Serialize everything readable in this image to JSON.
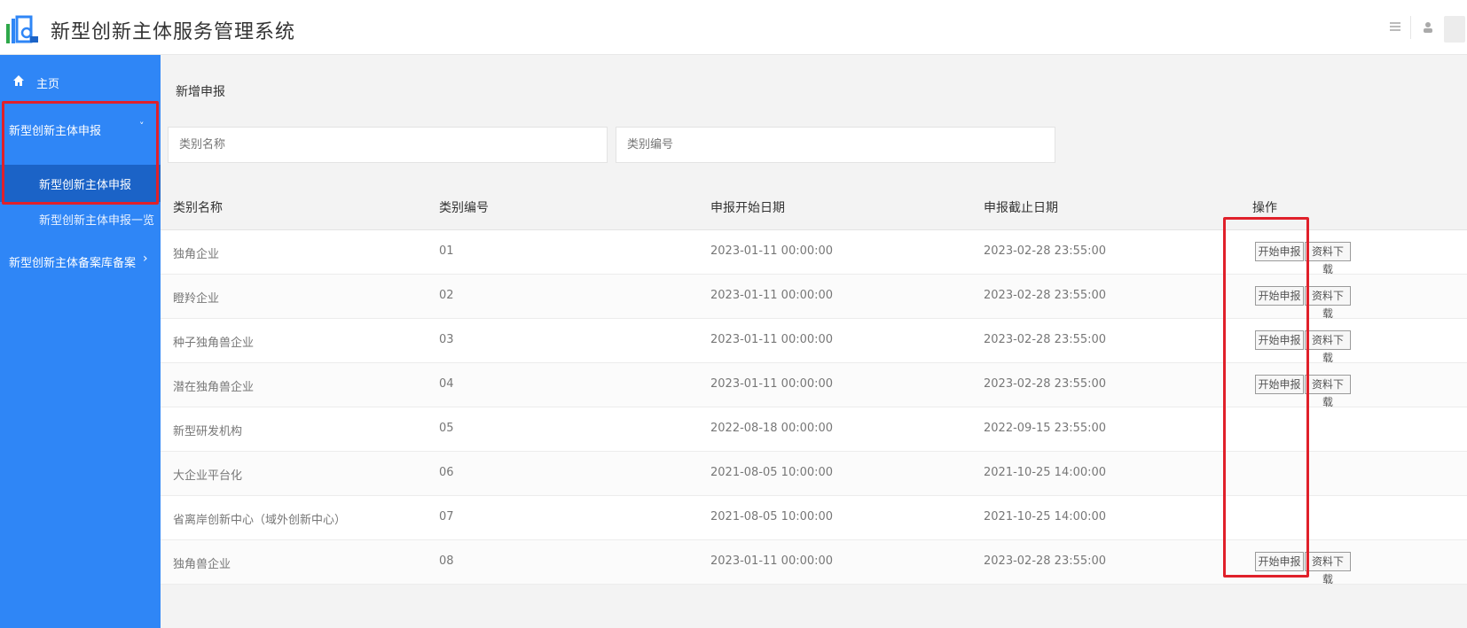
{
  "app": {
    "title": "新型创新主体服务管理系统",
    "user_label": ""
  },
  "sidebar": {
    "home": {
      "icon": "home-icon",
      "label": "主页"
    },
    "group1": {
      "label": "新型创新主体申报",
      "chevron": "˅"
    },
    "sub_active": {
      "label": "新型创新主体申报"
    },
    "sub2": {
      "label": "新型创新主体申报一览"
    },
    "group2": {
      "label": "新型创新主体备案库备案",
      "chevron": "›"
    }
  },
  "main": {
    "panel_title": "新增申报",
    "search": {
      "name_placeholder": "类别名称",
      "code_placeholder": "类别编号"
    },
    "table": {
      "headers": [
        "类别名称",
        "类别编号",
        "申报开始日期",
        "申报截止日期",
        "操作"
      ],
      "start_label": "开始申报",
      "download_label": "资料下载",
      "rows": [
        {
          "name": "独角企业",
          "code": "01",
          "start": "2023-01-11 00:00:00",
          "end": "2023-02-28 23:55:00",
          "actions": true
        },
        {
          "name": "瞪羚企业",
          "code": "02",
          "start": "2023-01-11 00:00:00",
          "end": "2023-02-28 23:55:00",
          "actions": true
        },
        {
          "name": "种子独角兽企业",
          "code": "03",
          "start": "2023-01-11 00:00:00",
          "end": "2023-02-28 23:55:00",
          "actions": true
        },
        {
          "name": "潜在独角兽企业",
          "code": "04",
          "start": "2023-01-11 00:00:00",
          "end": "2023-02-28 23:55:00",
          "actions": true
        },
        {
          "name": "新型研发机构",
          "code": "05",
          "start": "2022-08-18 00:00:00",
          "end": "2022-09-15 23:55:00",
          "actions": false
        },
        {
          "name": "大企业平台化",
          "code": "06",
          "start": "2021-08-05 10:00:00",
          "end": "2021-10-25 14:00:00",
          "actions": false
        },
        {
          "name": "省离岸创新中心（域外创新中心）",
          "code": "07",
          "start": "2021-08-05 10:00:00",
          "end": "2021-10-25 14:00:00",
          "actions": false
        },
        {
          "name": "独角兽企业",
          "code": "08",
          "start": "2023-01-11 00:00:00",
          "end": "2023-02-28 23:55:00",
          "actions": true
        }
      ]
    }
  },
  "colors": {
    "sidebar": "#2f86f6",
    "sidebar_active": "#1b63c7",
    "highlight": "#e0202a"
  }
}
